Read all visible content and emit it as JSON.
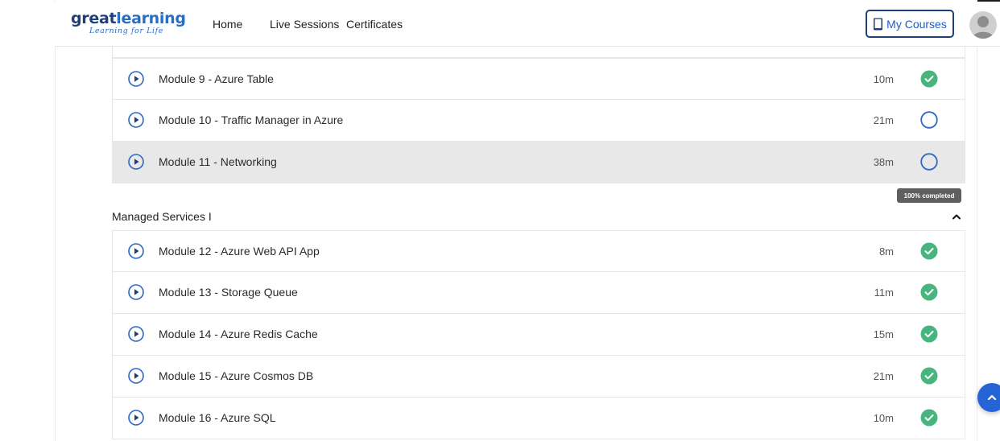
{
  "header": {
    "logo_word1": "great",
    "logo_word2": "learning",
    "logo_tagline": "Learning for Life",
    "nav": [
      "Home",
      "Live Sessions",
      "Certificates"
    ],
    "my_courses_label": "My Courses"
  },
  "modules_top": [
    {
      "title": "Module 9 - Azure Table",
      "duration": "10m",
      "completed": true
    },
    {
      "title": "Module 10 - Traffic Manager in Azure",
      "duration": "21m",
      "completed": false
    },
    {
      "title": "Module 11 - Networking",
      "duration": "38m",
      "completed": false
    }
  ],
  "tooltip": "100% completed",
  "section": {
    "title": "Managed Services I",
    "modules": [
      {
        "title": "Module 12 - Azure Web API App",
        "duration": "8m",
        "completed": true
      },
      {
        "title": "Module 13 - Storage Queue",
        "duration": "11m",
        "completed": true
      },
      {
        "title": "Module 14 - Azure Redis Cache",
        "duration": "15m",
        "completed": true
      },
      {
        "title": "Module 15 - Azure Cosmos DB",
        "duration": "21m",
        "completed": true
      },
      {
        "title": "Module 16 - Azure SQL",
        "duration": "10m",
        "completed": true
      }
    ]
  },
  "colors": {
    "brand_dark": "#1e3f7a",
    "brand_blue": "#2a6dc1",
    "complete_green": "#48b57f",
    "pending_blue": "#2f66c8",
    "highlight_row": "#e8e8e8"
  },
  "icons": {
    "play": "play-circle-icon",
    "done": "check-circle-icon",
    "pending": "empty-circle-icon",
    "collapse": "chevron-up-icon",
    "scroll_top": "arrow-up-icon",
    "my_courses": "book-icon",
    "avatar": "user-avatar-icon"
  }
}
